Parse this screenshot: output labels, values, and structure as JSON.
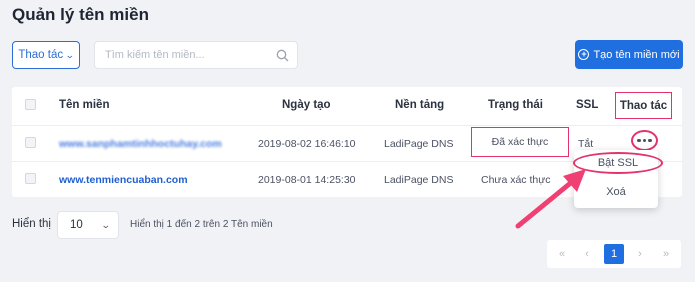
{
  "page": {
    "title": "Quản lý tên miền"
  },
  "toolbar": {
    "action_label": "Thao tác",
    "search_placeholder": "Tìm kiếm tên miền...",
    "create_label": "Tạo tên miền mới"
  },
  "table": {
    "headers": {
      "domain": "Tên miền",
      "created": "Ngày tạo",
      "platform": "Nền tảng",
      "status": "Trạng thái",
      "ssl": "SSL",
      "action": "Thao tác"
    },
    "rows": [
      {
        "domain": "www.sanphamtinhhoctuhay.com",
        "created": "2019-08-02 16:46:10",
        "platform": "LadiPage DNS",
        "status": "Đã xác thực",
        "ssl": "Tắt"
      },
      {
        "domain": "www.tenmiencuaban.com",
        "created": "2019-08-01 14:25:30",
        "platform": "LadiPage DNS",
        "status": "Chưa xác thực",
        "ssl": ""
      }
    ]
  },
  "row_menu": {
    "enable_ssl": "Bật SSL",
    "delete": "Xoá"
  },
  "footer": {
    "show_label": "Hiển thị",
    "page_size": "10",
    "summary": "Hiển thị 1 đến 2 trên 2 Tên miền"
  },
  "pagination": {
    "first": "«",
    "prev": "‹",
    "current": "1",
    "next": "›",
    "last": "»"
  },
  "colors": {
    "primary": "#1f6fe0",
    "highlight": "#e2336c",
    "link": "#1f5fd1"
  },
  "icons": [
    "search-icon",
    "chevron-down-icon",
    "plus-circle-icon",
    "more-dots-icon",
    "arrow-annotation"
  ]
}
